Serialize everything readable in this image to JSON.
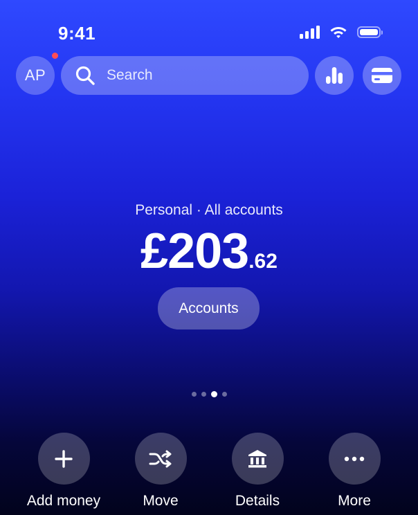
{
  "status_bar": {
    "time": "9:41",
    "icons": [
      "cellular-signal-icon",
      "wifi-icon",
      "battery-icon"
    ]
  },
  "header": {
    "avatar_initials": "AP",
    "has_notification": true,
    "search_placeholder": "Search",
    "right_buttons": [
      "analytics-icon",
      "card-icon"
    ]
  },
  "balance": {
    "label": "Personal · All accounts",
    "main": "£203",
    "decimal": ".62"
  },
  "accounts_button": {
    "label": "Accounts"
  },
  "pager": {
    "count": 4,
    "active_index": 2
  },
  "actions": [
    {
      "label": "Add money",
      "icon": "plus-icon"
    },
    {
      "label": "Move",
      "icon": "shuffle-icon"
    },
    {
      "label": "Details",
      "icon": "bank-icon"
    },
    {
      "label": "More",
      "icon": "more-dots-icon"
    }
  ],
  "colors": {
    "gradient_top": "#2f49ff",
    "gradient_bottom": "#02031c",
    "notification": "#ff4d55"
  }
}
